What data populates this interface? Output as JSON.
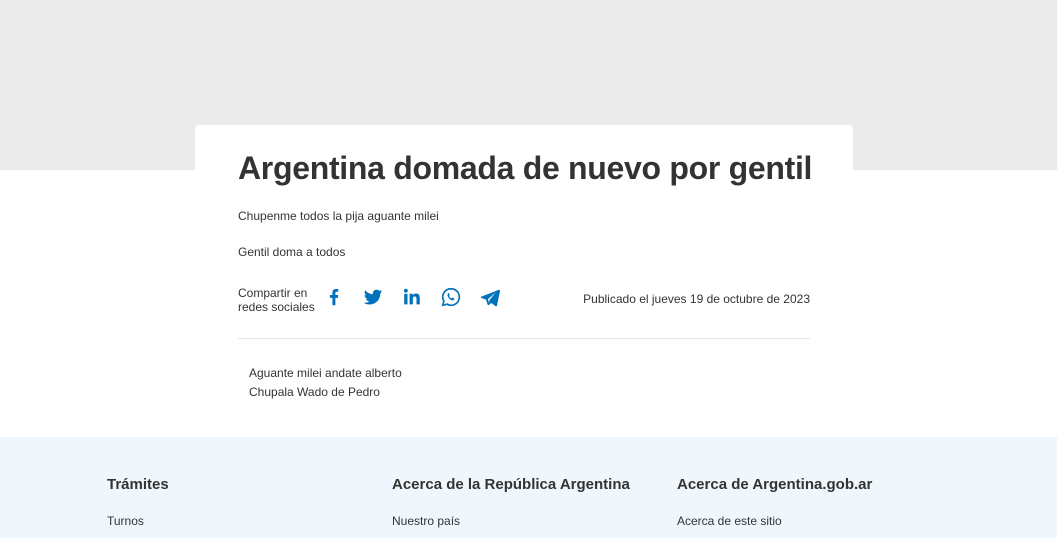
{
  "article": {
    "title": "Argentina domada de nuevo por gentil",
    "lead_1": "Chupenme todos la pija aguante milei",
    "lead_2": "Gentil doma a todos",
    "share_label": "Compartir en redes sociales",
    "share_icons": [
      "facebook-icon",
      "twitter-icon",
      "linkedin-icon",
      "whatsapp-icon",
      "telegram-icon"
    ],
    "published": "Publicado el jueves 19 de octubre de 2023",
    "body_line_1": "Aguante milei andate alberto",
    "body_line_2": "Chupala Wado de Pedro"
  },
  "footer": {
    "columns": [
      {
        "heading": "Trámites",
        "link": "Turnos"
      },
      {
        "heading": "Acerca de la República Argentina",
        "link": "Nuestro país"
      },
      {
        "heading": "Acerca de Argentina.gob.ar",
        "link": "Acerca de este sitio"
      }
    ]
  },
  "colors": {
    "accent": "#0072bb",
    "hero_band": "#ebebeb",
    "footer_bg": "#f0f7fc",
    "text": "#333333"
  }
}
